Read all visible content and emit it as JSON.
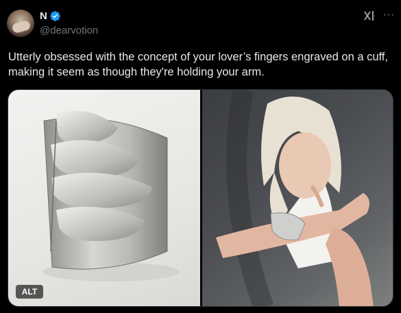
{
  "author": {
    "display_name": "N",
    "handle": "@dearvotion",
    "verified": true,
    "avatar_icon": "avatar-photo"
  },
  "actions": {
    "grok_icon": "grok-icon",
    "more_icon": "more-icon",
    "more_symbol": "···"
  },
  "tweet": {
    "text": "Utterly obsessed with the concept of your lover’s fingers engraved on a cuff, making it seem as though they're holding your arm."
  },
  "media": {
    "alt_label": "ALT",
    "images": [
      {
        "name": "silver-finger-cuff-photo"
      },
      {
        "name": "woman-wearing-cuff-photo"
      }
    ]
  },
  "colors": {
    "background": "#000000",
    "text": "#e7e9ea",
    "secondary": "#71767b",
    "verified_blue": "#1d9bf0",
    "border": "#2f3336"
  }
}
